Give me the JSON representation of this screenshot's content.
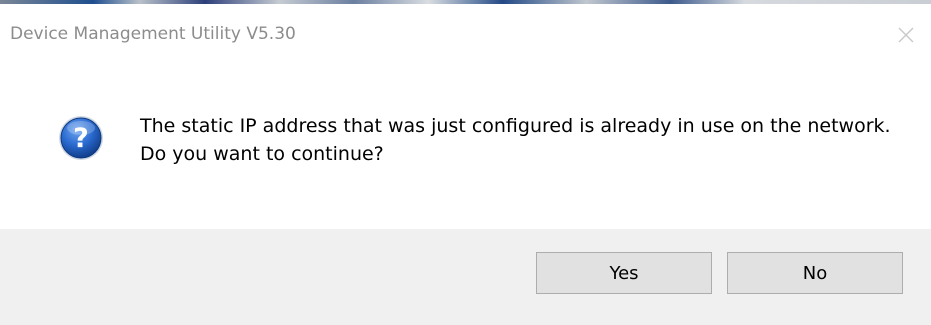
{
  "window": {
    "title": "Device Management Utility V5.30",
    "close_icon": "close-icon"
  },
  "message": {
    "icon": "question-icon",
    "text": "The static IP address that was just configured is already in use on the network. Do you want to continue?"
  },
  "buttons": {
    "yes_label": "Yes",
    "no_label": "No"
  },
  "colors": {
    "footer_bg": "#f0f0f0",
    "icon_blue": "#1f5cb8",
    "title_gray": "#8c8c8c"
  }
}
